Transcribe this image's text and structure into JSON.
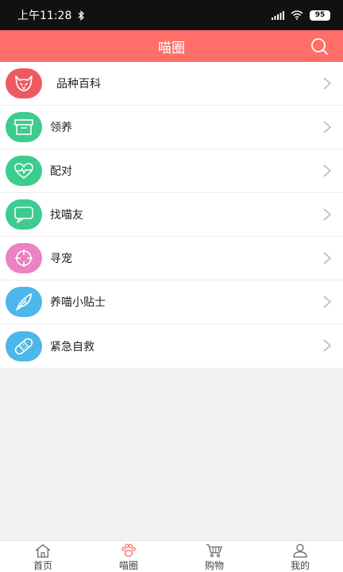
{
  "status_bar": {
    "time": "上午11:28",
    "battery": "95"
  },
  "header": {
    "title": "喵圈"
  },
  "list": [
    {
      "label": "品种百科",
      "icon": "fox-face-icon",
      "color": "#ef5a62"
    },
    {
      "label": "领养",
      "icon": "box-icon",
      "color": "#3dcb8e"
    },
    {
      "label": "配对",
      "icon": "heartbeat-icon",
      "color": "#3dcb8e"
    },
    {
      "label": "找喵友",
      "icon": "chat-bubble-icon",
      "color": "#3dcb8e"
    },
    {
      "label": "寻宠",
      "icon": "crosshair-icon",
      "color": "#e983c2"
    },
    {
      "label": "养喵小贴士",
      "icon": "feather-icon",
      "color": "#4cb7e8"
    },
    {
      "label": "紧急自救",
      "icon": "bandage-icon",
      "color": "#4cb7e8"
    }
  ],
  "tabs": [
    {
      "label": "首页",
      "icon": "house-icon"
    },
    {
      "label": "喵圈",
      "icon": "paw-icon",
      "active": true,
      "color": "#ff6e68"
    },
    {
      "label": "购物",
      "icon": "cart-icon"
    },
    {
      "label": "我的",
      "icon": "person-icon"
    }
  ]
}
